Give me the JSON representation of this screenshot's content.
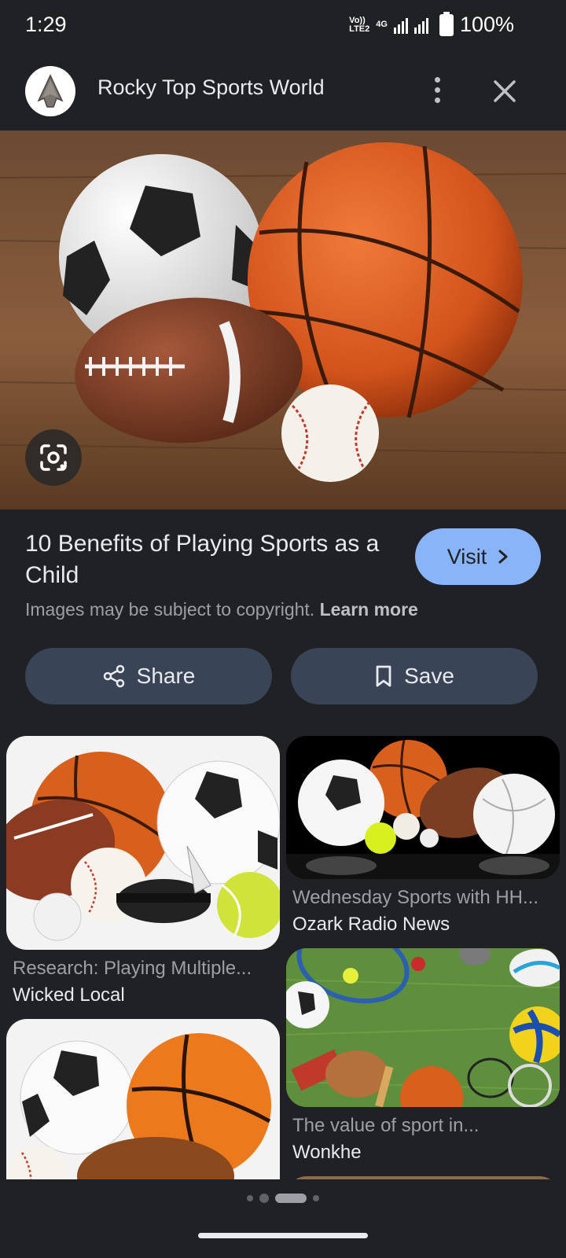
{
  "status_bar": {
    "time": "1:29",
    "network_top": "Vo))",
    "network_bottom": "LTE2",
    "network_type": "4G",
    "battery": "100%"
  },
  "header": {
    "site_name": "Rocky Top Sports World",
    "avatar_icon": "arrowhead-logo-icon",
    "more_icon": "more-vert-icon",
    "close_icon": "close-icon"
  },
  "hero": {
    "image_description": "sports balls on wooden floor",
    "lens_icon": "google-lens-icon"
  },
  "result": {
    "title": "10 Benefits of Playing Sports as a Child",
    "visit_label": "Visit",
    "copyright_text": "Images may be subject to copyright.",
    "learn_more": "Learn more"
  },
  "actions": {
    "share_label": "Share",
    "save_label": "Save"
  },
  "related": [
    {
      "title": "Research: Playing Multiple...",
      "source": "Wicked Local"
    },
    {
      "title": "Wednesday Sports with HH...",
      "source": "Ozark Radio News"
    },
    {
      "title": "The value of sport in...",
      "source": "Wonkhe"
    },
    {
      "title": "",
      "source": ""
    },
    {
      "title": "",
      "source": ""
    }
  ],
  "colors": {
    "background": "#202124",
    "accent": "#8ab4f8",
    "action_button": "#394457"
  }
}
